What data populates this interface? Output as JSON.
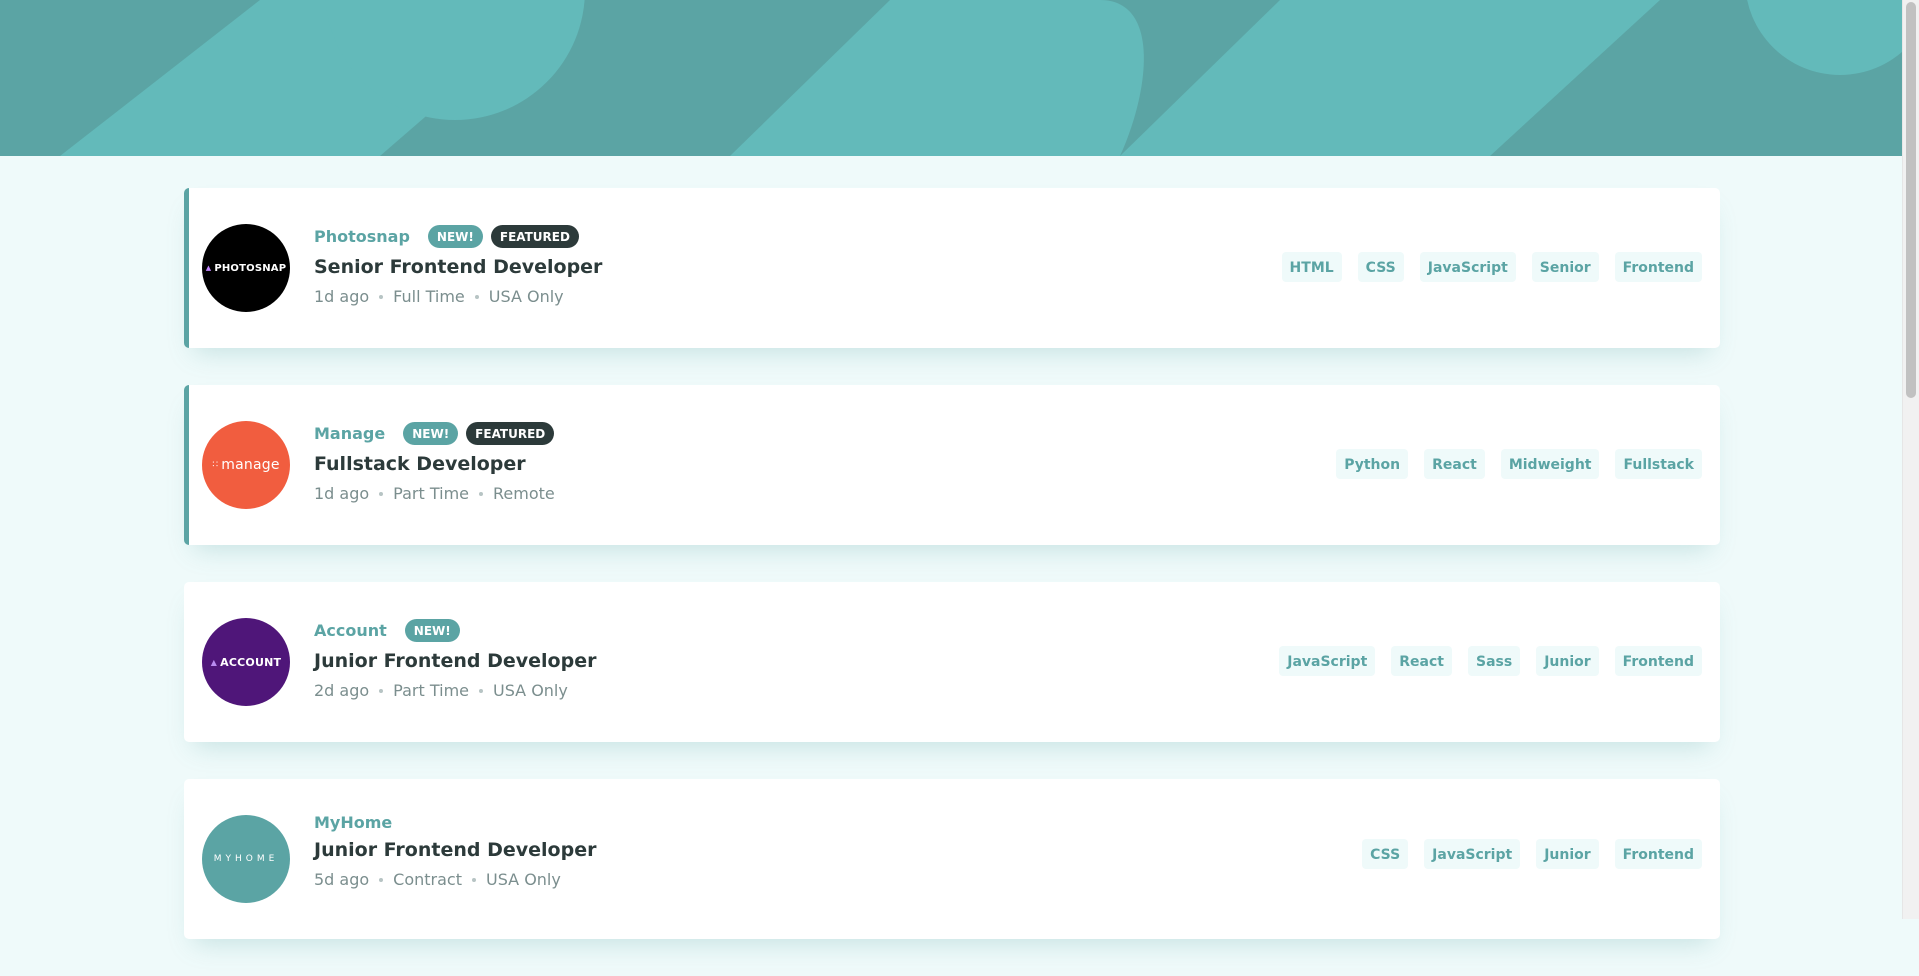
{
  "colors": {
    "accent": "#5ba4a4",
    "dark": "#2c3a3a",
    "muted": "#7b8e8e",
    "background": "#effafa",
    "tag_background": "#effafa"
  },
  "jobs": [
    {
      "company": "Photosnap",
      "logo_text": "PHOTOSNAP",
      "logo_color": "#000000",
      "new_label": "NEW!",
      "featured_label": "FEATURED",
      "position": "Senior Frontend Developer",
      "posted": "1d ago",
      "contract": "Full Time",
      "location": "USA Only",
      "tags": [
        "HTML",
        "CSS",
        "JavaScript",
        "Senior",
        "Frontend"
      ]
    },
    {
      "company": "Manage",
      "logo_text": "manage",
      "logo_color": "#f15d3f",
      "new_label": "NEW!",
      "featured_label": "FEATURED",
      "position": "Fullstack Developer",
      "posted": "1d ago",
      "contract": "Part Time",
      "location": "Remote",
      "tags": [
        "Python",
        "React",
        "Midweight",
        "Fullstack"
      ]
    },
    {
      "company": "Account",
      "logo_text": "ACCOUNT",
      "logo_color": "#4f1679",
      "new_label": "NEW!",
      "position": "Junior Frontend Developer",
      "posted": "2d ago",
      "contract": "Part Time",
      "location": "USA Only",
      "tags": [
        "JavaScript",
        "React",
        "Sass",
        "Junior",
        "Frontend"
      ]
    },
    {
      "company": "MyHome",
      "logo_text": "MYHOME",
      "logo_color": "#5ba4a4",
      "position": "Junior Frontend Developer",
      "posted": "5d ago",
      "contract": "Contract",
      "location": "USA Only",
      "tags": [
        "CSS",
        "JavaScript",
        "Junior",
        "Frontend"
      ]
    }
  ]
}
